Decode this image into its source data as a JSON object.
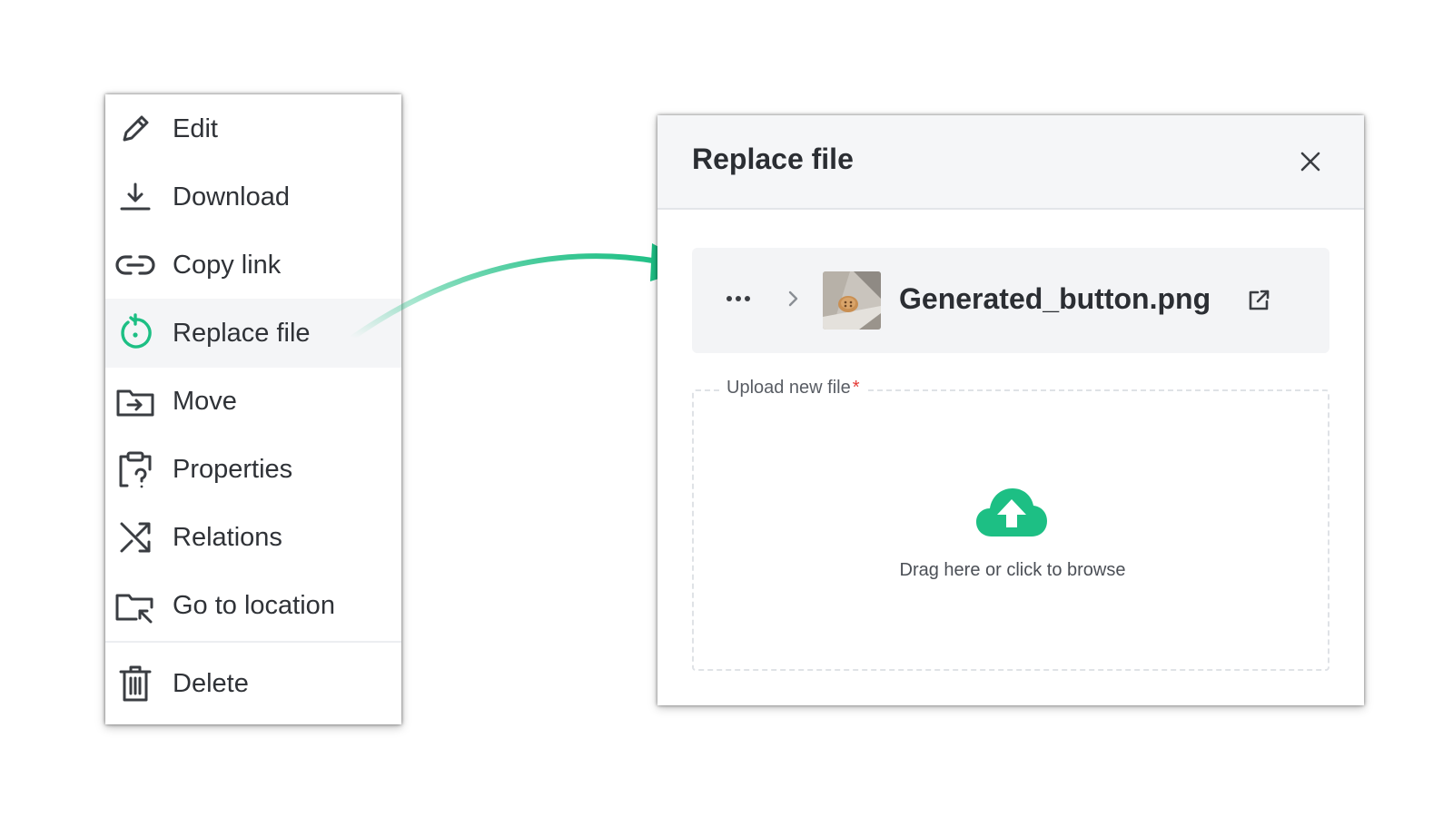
{
  "menu": {
    "items": [
      {
        "label": "Edit",
        "icon": "pencil-icon"
      },
      {
        "label": "Download",
        "icon": "download-icon"
      },
      {
        "label": "Copy link",
        "icon": "link-icon"
      },
      {
        "label": "Replace file",
        "icon": "replace-icon",
        "active": true
      },
      {
        "label": "Move",
        "icon": "folder-move-icon"
      },
      {
        "label": "Properties",
        "icon": "clipboard-question-icon"
      },
      {
        "label": "Relations",
        "icon": "shuffle-icon"
      },
      {
        "label": "Go to location",
        "icon": "folder-goto-icon"
      },
      {
        "label": "Delete",
        "icon": "trash-icon"
      }
    ]
  },
  "dialog": {
    "title": "Replace file",
    "close_icon": "close-icon",
    "file": {
      "name": "Generated_button.png",
      "path_icon": "more-dots-icon",
      "separator_icon": "chevron-right-icon",
      "open_icon": "external-link-icon"
    },
    "upload": {
      "label": "Upload new file",
      "required_mark": "*",
      "hint": "Drag here or click to browse",
      "icon": "cloud-upload-icon"
    }
  },
  "colors": {
    "accent": "#1dbf84",
    "required": "#e53935",
    "active_row": "#f4f5f7"
  }
}
